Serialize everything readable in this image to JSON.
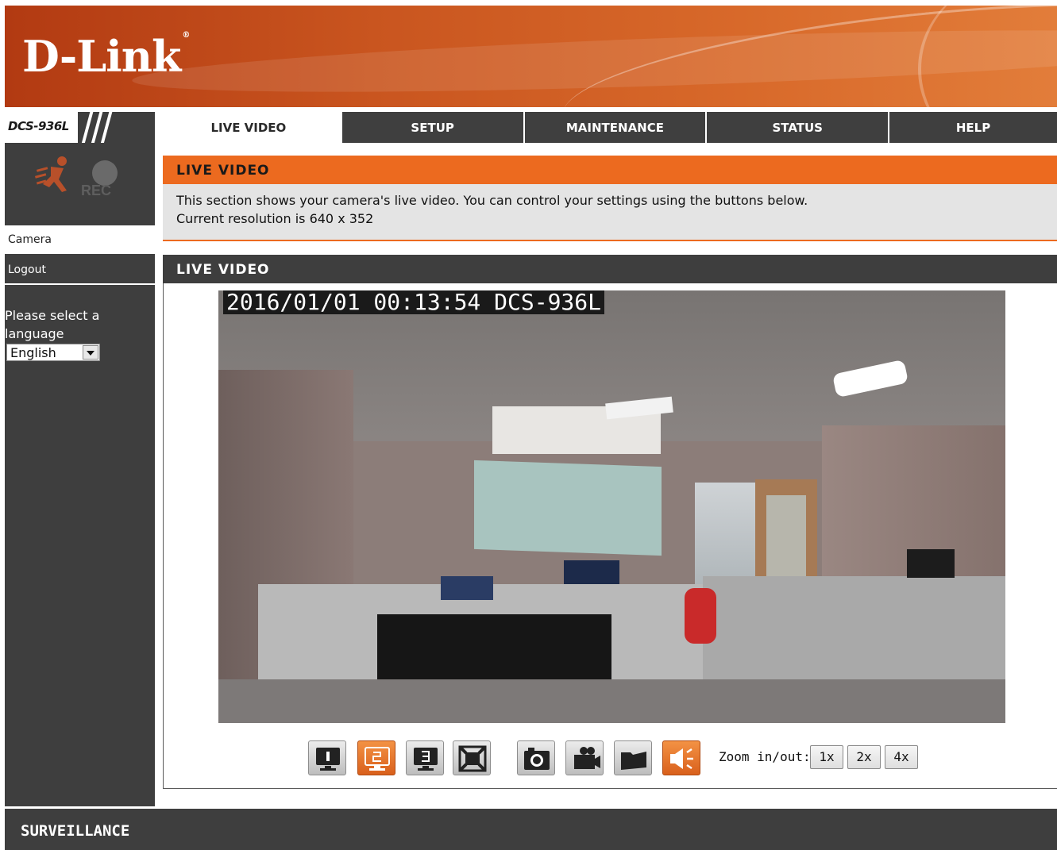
{
  "brand": {
    "logo_text": "D-Link",
    "model": "DCS-936L"
  },
  "nav": {
    "tabs": [
      {
        "label": "LIVE VIDEO",
        "active": true
      },
      {
        "label": "SETUP",
        "active": false
      },
      {
        "label": "MAINTENANCE",
        "active": false
      },
      {
        "label": "STATUS",
        "active": false
      },
      {
        "label": "HELP",
        "active": false
      }
    ]
  },
  "sidebar": {
    "rec_label": "REC",
    "items": [
      {
        "label": "Camera"
      },
      {
        "label": "Logout"
      }
    ],
    "language_prompt": "Please select a language",
    "language_value": "English"
  },
  "info": {
    "title": "LIVE VIDEO",
    "line1": "This section shows your camera's live video. You can control your settings using the buttons below.",
    "line2": "Current resolution is 640 x 352"
  },
  "live": {
    "title": "LIVE VIDEO",
    "timestamp_overlay": "2016/01/01 00:13:54 DCS-936L",
    "zoom_label": "Zoom in/out:",
    "zoom_options": [
      "1x",
      "2x",
      "4x"
    ],
    "controls": [
      {
        "name": "profile-1-button",
        "icon": "profile-1-icon",
        "active": false
      },
      {
        "name": "profile-2-button",
        "icon": "profile-2-icon",
        "active": true
      },
      {
        "name": "profile-3-button",
        "icon": "profile-3-icon",
        "active": false
      },
      {
        "name": "fullscreen-button",
        "icon": "fullscreen-icon",
        "active": false
      },
      {
        "name": "snapshot-button",
        "icon": "camera-icon",
        "active": false
      },
      {
        "name": "record-button",
        "icon": "video-camera-icon",
        "active": false
      },
      {
        "name": "storage-folder-button",
        "icon": "folder-icon",
        "active": false
      },
      {
        "name": "audio-button",
        "icon": "speaker-icon",
        "active": true
      }
    ]
  },
  "footer": {
    "text": "SURVEILLANCE"
  },
  "colors": {
    "accent": "#ec6a1f",
    "dark": "#3e3e3e",
    "header_start": "#b23a12",
    "header_end": "#e27d3a"
  }
}
